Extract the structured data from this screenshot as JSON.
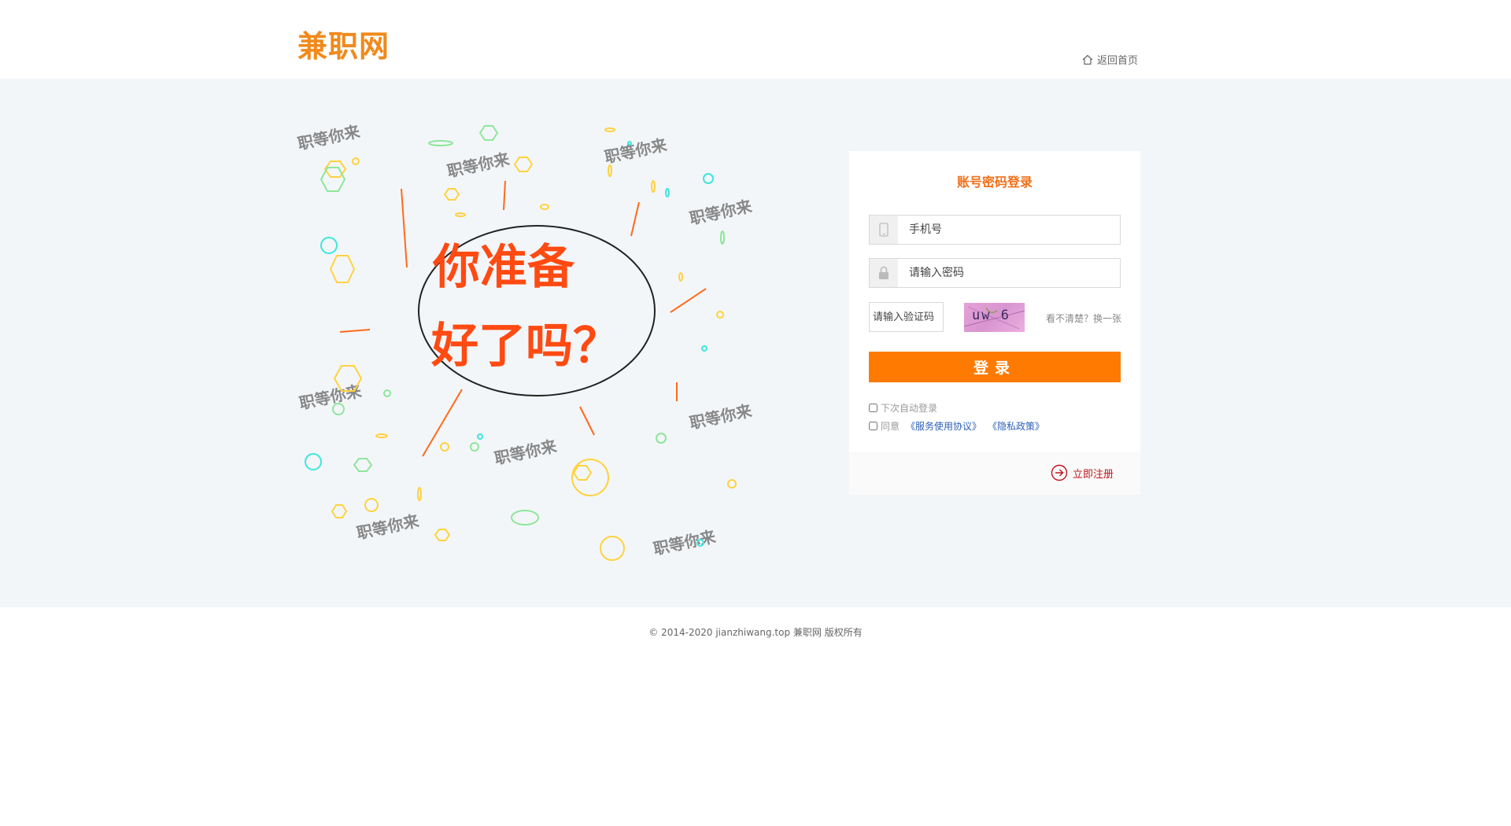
{
  "header": {
    "logo": "兼职网",
    "home_link": "返回首页"
  },
  "illustration": {
    "headline_line1": "你准备",
    "headline_line2": "好了吗？",
    "tag": "职等你来",
    "colors": {
      "orange": "#ff5a1a",
      "yellow": "#ffd23f",
      "cyan": "#3de6e0",
      "green": "#8ee69a"
    }
  },
  "login": {
    "title": "账号密码登录",
    "phone_placeholder": "手机号",
    "password_placeholder": "请输入密码",
    "captcha_placeholder": "请输入验证码",
    "captcha_text": "uw 6",
    "captcha_refresh": "看不清楚？换一张",
    "submit": "登录",
    "remember": "下次自动登录",
    "agree": "同意",
    "terms_link": "《服务使用协议》",
    "privacy_link": "《隐私政策》",
    "register": "立即注册"
  },
  "footer": {
    "copyright": "© 2014-2020 jianzhiwang.top 兼职网  版权所有"
  },
  "colors": {
    "accent": "#ff7a00",
    "logo": "#f08a1c",
    "background": "#f3f6f9"
  }
}
